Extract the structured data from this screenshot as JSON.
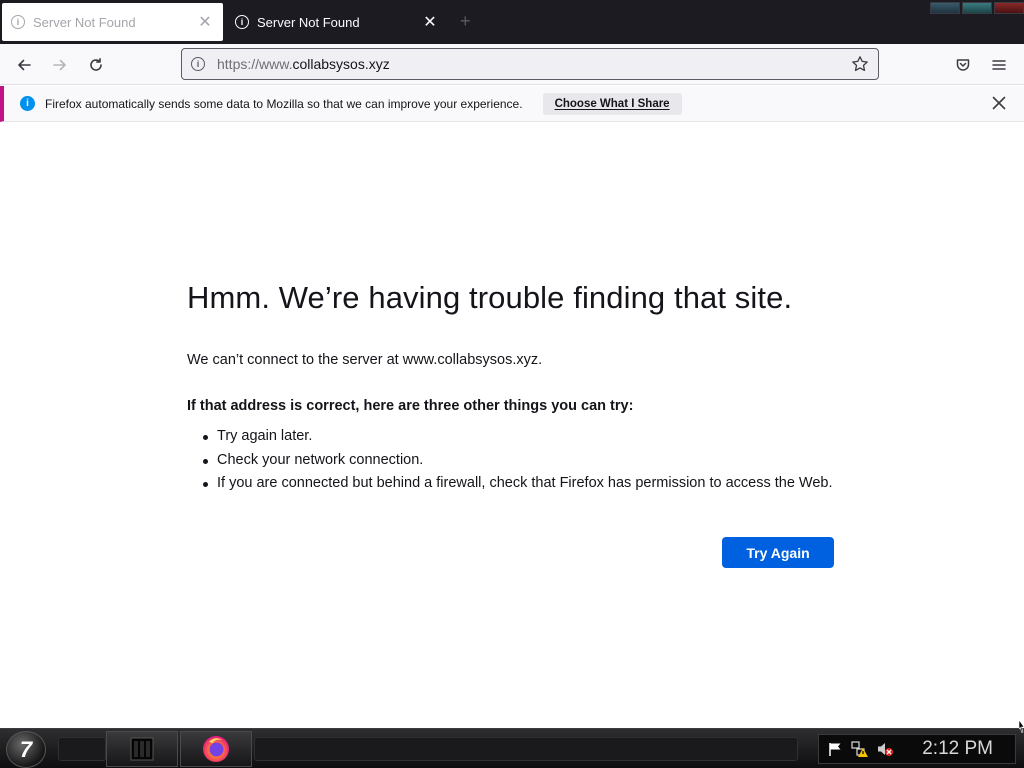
{
  "tabs": [
    {
      "title": "Server Not Found",
      "active": false
    },
    {
      "title": "Server Not Found",
      "active": true
    }
  ],
  "tab_icons": {
    "info": "info-circle-icon",
    "close": "close-icon",
    "new_tab": "plus-icon"
  },
  "navbar": {
    "url_prefix": "https://www.",
    "url_domain": "collabsysos.xyz",
    "icons": [
      "back-arrow-icon",
      "forward-arrow-icon",
      "reload-icon",
      "info-icon",
      "bookmark-star-icon",
      "pocket-icon",
      "hamburger-menu-icon"
    ]
  },
  "notification": {
    "text": "Firefox automatically sends some data to Mozilla so that we can improve your experience.",
    "button": "Choose What I Share",
    "accent": "#c2128a"
  },
  "error": {
    "title": "Hmm. We’re having trouble finding that site.",
    "description": "We can’t connect to the server at www.collabsysos.xyz.",
    "suggest_heading": "If that address is correct, here are three other things you can try:",
    "suggestions": [
      "Try again later.",
      "Check your network connection.",
      "If you are connected but behind a firewall, check that Firefox has permission to access the Web."
    ],
    "button": "Try Again",
    "button_color": "#0061e0"
  },
  "taskbar": {
    "clock": "2:12 PM",
    "start_glyph": "7",
    "tray_icons": [
      "flag-icon",
      "network-warning-icon",
      "volume-muted-icon"
    ]
  }
}
